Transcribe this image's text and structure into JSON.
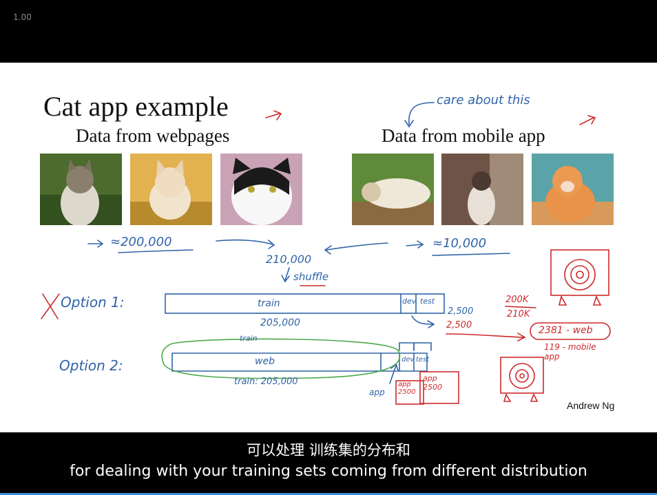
{
  "player": {
    "speed": "1.00"
  },
  "slide": {
    "title": "Cat app example",
    "web_heading": "Data from webpages",
    "mobile_heading": "Data from mobile app",
    "credit": "Andrew Ng",
    "annotations": {
      "care_about_this": "care about this",
      "web_count": "≈200,000",
      "mobile_count": "≈10,000",
      "total": "210,000",
      "shuffle": "shuffle",
      "option1_label": "Option 1:",
      "option1_train": "train",
      "option1_dev": "dev",
      "option1_test": "test",
      "option1_train_size": "205,000",
      "option1_dev_size": "2,500",
      "option1_test_size": "2,500",
      "ratio_top": "200K",
      "ratio_bottom": "210K",
      "web_in_dev": "2381 - web",
      "mobile_in_dev": "119 - mobile app",
      "option2_label": "Option 2:",
      "option2_train_top": "train",
      "option2_web": "web",
      "option2_dev": "dev",
      "option2_test": "test",
      "option2_train_size": "train: 205,000",
      "option2_app": "app",
      "option2_dev_app": "app 2500",
      "option2_test_app": "app 2500"
    }
  },
  "subtitles": {
    "zh": "可以处理 训练集的分布和",
    "en": "for dealing with your training sets coming from different distribution"
  },
  "colors": {
    "blue_ink": "#2f63a8",
    "red_ink": "#cc2a2a",
    "green_ink": "#4aa84a"
  }
}
